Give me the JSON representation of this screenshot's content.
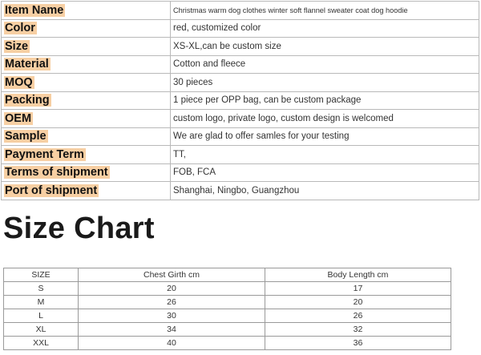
{
  "spec_rows": [
    {
      "label": "Item Name",
      "value": "Christmas warm dog clothes winter soft flannel sweater coat dog  hoodie"
    },
    {
      "label": "Color",
      "value": "red, customized color"
    },
    {
      "label": "Size",
      "value": "XS-XL,can be custom size"
    },
    {
      "label": "Material",
      "value": "Cotton and fleece"
    },
    {
      "label": "MOQ",
      "value": "30 pieces"
    },
    {
      "label": "Packing",
      "value": "1 piece per OPP bag, can be custom package"
    },
    {
      "label": "OEM",
      "value": "custom logo, private logo, custom design is welcomed"
    },
    {
      "label": "Sample",
      "value": "We are glad to offer samles for your testing"
    },
    {
      "label": "Payment Term",
      "value": "TT,"
    },
    {
      "label": "Terms of shipment",
      "value": "FOB, FCA"
    },
    {
      "label": "Port of shipment",
      "value": "Shanghai, Ningbo, Guangzhou"
    }
  ],
  "size_chart": {
    "title": "Size Chart",
    "headers": [
      "SIZE",
      "Chest Girth cm",
      "Body Length cm"
    ],
    "rows": [
      [
        "S",
        "20",
        "17"
      ],
      [
        "M",
        "26",
        "20"
      ],
      [
        "L",
        "30",
        "26"
      ],
      [
        "XL",
        "34",
        "32"
      ],
      [
        "XXL",
        "40",
        "36"
      ]
    ]
  },
  "colors": {
    "label_highlight": "#f7cfa3",
    "border": "#b9b9b9"
  }
}
